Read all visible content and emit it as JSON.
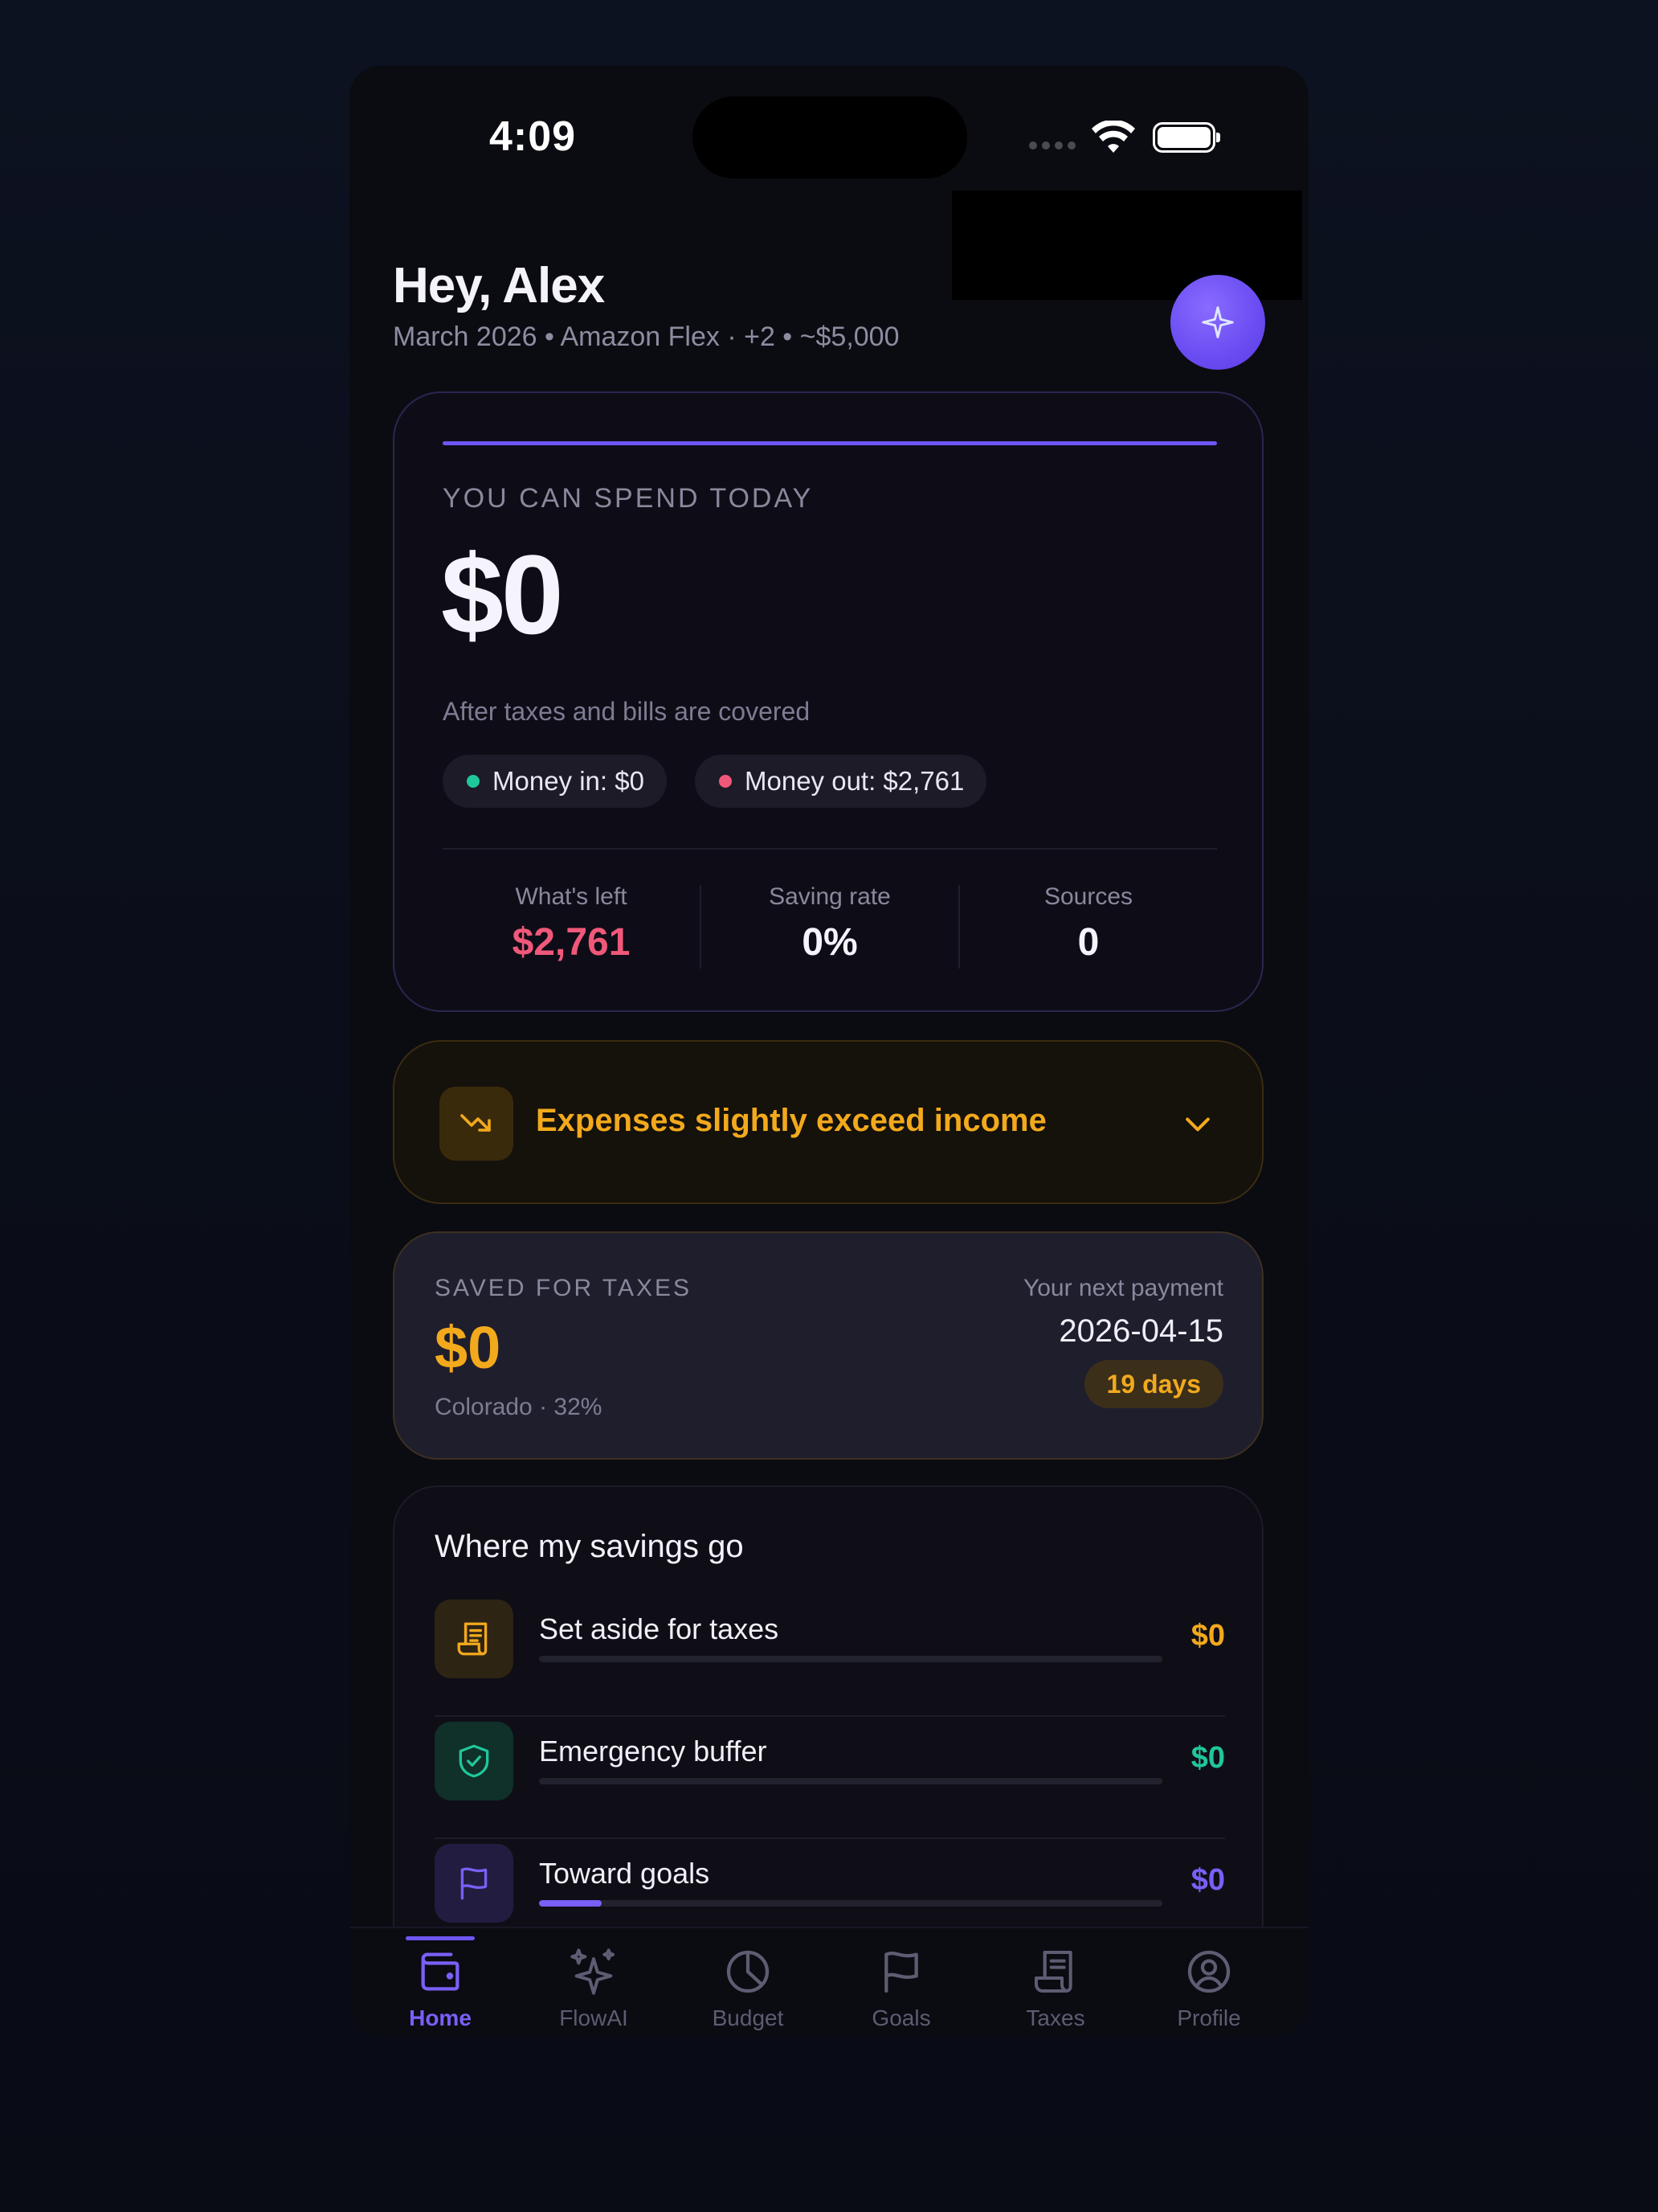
{
  "status_bar": {
    "time": "4:09"
  },
  "header": {
    "title": "Hey, Alex",
    "subtitle": "March 2026 • Amazon Flex · +2 • ~$5,000"
  },
  "spend_card": {
    "label": "YOU CAN SPEND TODAY",
    "amount": "$0",
    "note": "After taxes and bills are covered",
    "money_in": "Money in: $0",
    "money_out": "Money out: $2,761",
    "stats": [
      {
        "label": "What's left",
        "value": "$2,761",
        "color": "#f0587a"
      },
      {
        "label": "Saving rate",
        "value": "0%",
        "color": "#f5f3fb"
      },
      {
        "label": "Sources",
        "value": "0",
        "color": "#f5f3fb"
      }
    ]
  },
  "alert": {
    "text": "Expenses slightly exceed income"
  },
  "taxes": {
    "label": "SAVED FOR TAXES",
    "amount": "$0",
    "sub": "Colorado · 32%",
    "next_label": "Your next payment",
    "next_date": "2026-04-15",
    "days": "19 days"
  },
  "savings": {
    "title": "Where my savings go",
    "items": [
      {
        "name": "Set aside for taxes",
        "value": "$0",
        "icon": "receipt-icon",
        "color": "#f2a91c",
        "progress": 0
      },
      {
        "name": "Emergency buffer",
        "value": "$0",
        "icon": "shield-check-icon",
        "color": "#1fc79a",
        "progress": 0
      },
      {
        "name": "Toward goals",
        "value": "$0",
        "icon": "flag-icon",
        "color": "#7a5ff7",
        "progress": 0.1
      }
    ]
  },
  "tabs": [
    {
      "label": "Home",
      "icon": "wallet-icon",
      "active": true
    },
    {
      "label": "FlowAI",
      "icon": "sparkles-icon",
      "active": false
    },
    {
      "label": "Budget",
      "icon": "pie-chart-icon",
      "active": false
    },
    {
      "label": "Goals",
      "icon": "flag-icon",
      "active": false
    },
    {
      "label": "Taxes",
      "icon": "receipt-icon",
      "active": false
    },
    {
      "label": "Profile",
      "icon": "user-circle-icon",
      "active": false
    }
  ],
  "colors": {
    "accent": "#6e56f5",
    "warning": "#f2a91c",
    "success": "#1fc79a",
    "danger": "#f0587a"
  }
}
